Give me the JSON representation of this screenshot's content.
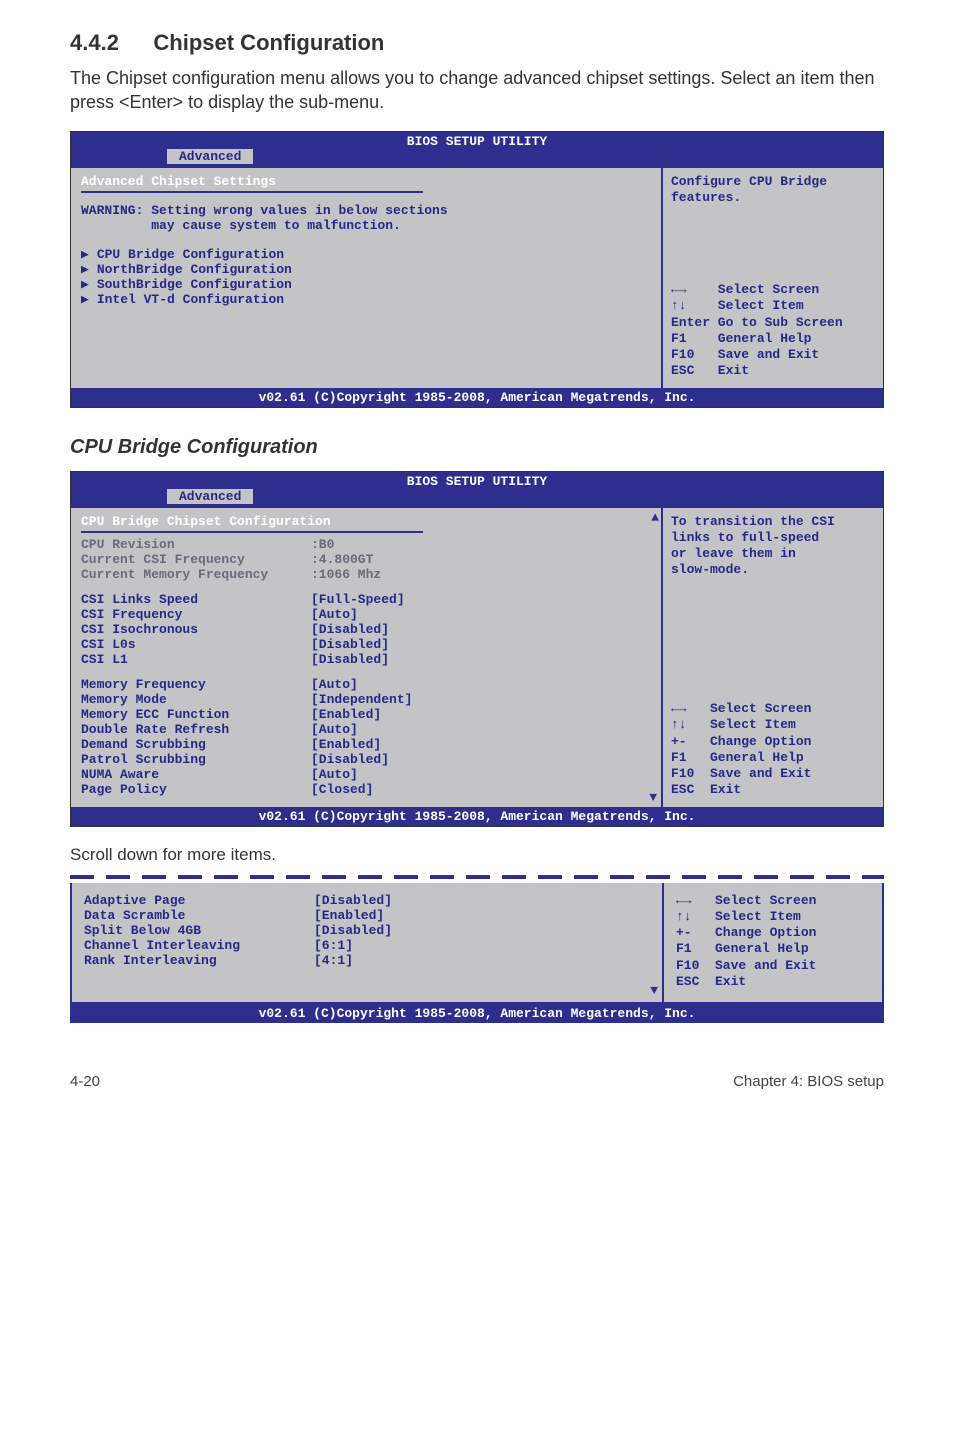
{
  "section": {
    "num": "4.4.2",
    "title": "Chipset Configuration"
  },
  "intro": "The Chipset configuration menu allows you to change advanced chipset settings. Select an item then press <Enter> to display the sub-menu.",
  "subheading": "CPU Bridge Configuration",
  "scroll_note": "Scroll down for more items.",
  "footer_copy": "v02.61 (C)Copyright 1985-2008, American Megatrends, Inc.",
  "bios_title": "BIOS SETUP UTILITY",
  "tab_label": "Advanced",
  "bios1": {
    "panel_title": "Advanced Chipset Settings",
    "warning_l1": "WARNING: Setting wrong values in below sections",
    "warning_l2": "         may cause system to malfunction.",
    "items": [
      "CPU Bridge Configuration",
      "NorthBridge Configuration",
      "SouthBridge Configuration",
      "Intel VT-d Configuration"
    ],
    "help": "Configure CPU Bridge\nfeatures.",
    "nav": "←→    Select Screen\n↑↓    Select Item\nEnter Go to Sub Screen\nF1    General Help\nF10   Save and Exit\nESC   Exit"
  },
  "bios2": {
    "panel_title": "CPU Bridge Chipset Configuration",
    "static": [
      {
        "k": "CPU Revision",
        "v": ":B0"
      },
      {
        "k": "Current CSI Frequency",
        "v": ":4.800GT"
      },
      {
        "k": "Current Memory Frequency",
        "v": ":1066 Mhz"
      }
    ],
    "group1": [
      {
        "k": "CSI Links Speed",
        "v": "[Full-Speed]"
      },
      {
        "k": "CSI Frequency",
        "v": "[Auto]"
      },
      {
        "k": "CSI Isochronous",
        "v": "[Disabled]"
      },
      {
        "k": "CSI L0s",
        "v": "[Disabled]"
      },
      {
        "k": "CSI L1",
        "v": "[Disabled]"
      }
    ],
    "group2": [
      {
        "k": "Memory Frequency",
        "v": "[Auto]"
      },
      {
        "k": "Memory Mode",
        "v": "[Independent]"
      },
      {
        "k": "Memory ECC Function",
        "v": "[Enabled]"
      },
      {
        "k": "Double Rate Refresh",
        "v": "[Auto]"
      },
      {
        "k": "Demand Scrubbing",
        "v": "[Enabled]"
      },
      {
        "k": "Patrol Scrubbing",
        "v": "[Disabled]"
      },
      {
        "k": "NUMA Aware",
        "v": "[Auto]"
      },
      {
        "k": "Page Policy",
        "v": "[Closed]"
      }
    ],
    "help": "To transition the CSI\nlinks to full-speed\nor leave them in\nslow-mode.",
    "nav": "←→   Select Screen\n↑↓   Select Item\n+-   Change Option\nF1   General Help\nF10  Save and Exit\nESC  Exit"
  },
  "frag": {
    "items": [
      {
        "k": "Adaptive Page",
        "v": "[Disabled]"
      },
      {
        "k": "Data Scramble",
        "v": "[Enabled]"
      },
      {
        "k": "Split Below 4GB",
        "v": "[Disabled]"
      },
      {
        "k": "Channel Interleaving",
        "v": "[6:1]"
      },
      {
        "k": "Rank Interleaving",
        "v": "[4:1]"
      }
    ],
    "nav": "←→   Select Screen\n↑↓   Select Item\n+-   Change Option\nF1   General Help\nF10  Save and Exit\nESC  Exit"
  },
  "page_footer": {
    "left": "4-20",
    "right": "Chapter 4: BIOS setup"
  }
}
